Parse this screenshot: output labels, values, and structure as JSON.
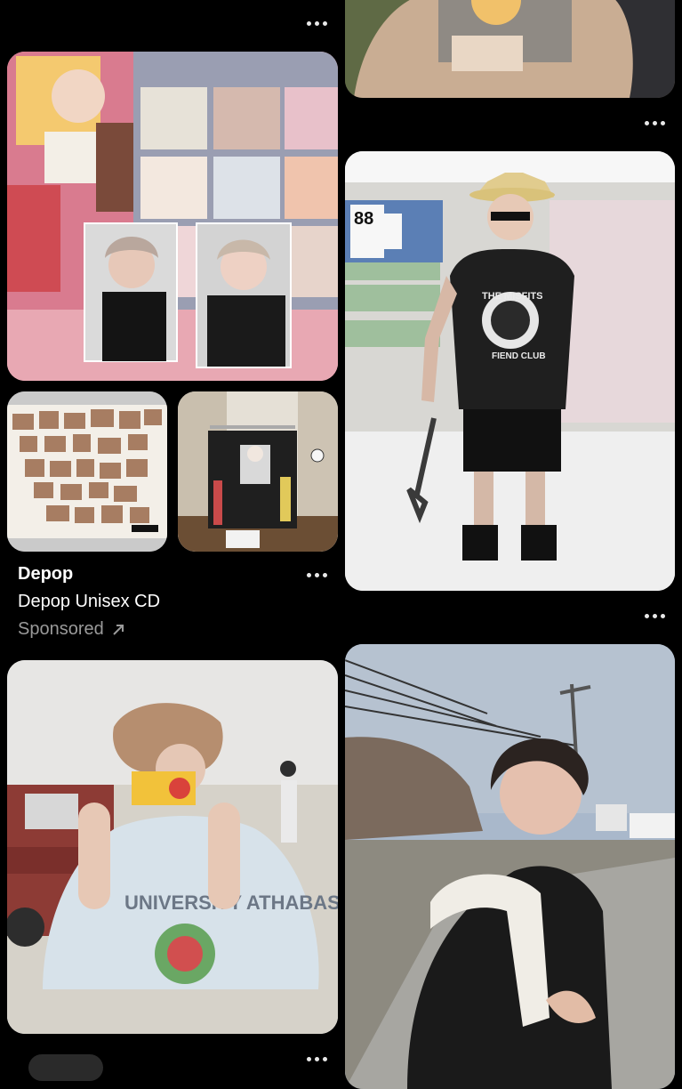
{
  "feed": {
    "left_column": {
      "ad_collage": {
        "advertiser": "Depop",
        "product_title": "Depop Unisex CD",
        "sponsored_label": "Sponsored",
        "hero_image": "kpop-photocards-image",
        "thumbnails": [
          "cd-booklet-image",
          "tshirt-rack-image"
        ]
      },
      "pins": [
        {
          "image": "man-with-disposable-camera-image",
          "shirt_text": "UNIVERSITY ATHABASCA"
        }
      ]
    },
    "right_column": {
      "pins": [
        {
          "image": "person-holding-album-image"
        },
        {
          "image": "man-in-cowboy-hat-store-image",
          "shirt_text": "THE MISFITS FIEND CLUB",
          "price_text": "88"
        },
        {
          "image": "man-by-road-image"
        }
      ]
    },
    "icons": {
      "more": "more-options-icon",
      "external": "external-link-icon"
    }
  }
}
